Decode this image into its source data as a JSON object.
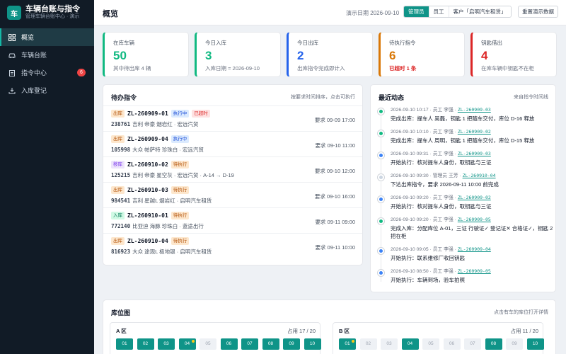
{
  "brand": {
    "logo": "车",
    "title": "车辆台账与指令",
    "subtitle": "管理车辆台账中心 · 演示"
  },
  "nav": [
    {
      "label": "概览",
      "icon": "grid-icon",
      "active": true
    },
    {
      "label": "车辆台账",
      "icon": "car-icon"
    },
    {
      "label": "指令中心",
      "icon": "clipboard-icon",
      "badge": "6"
    },
    {
      "label": "入库登记",
      "icon": "download-icon"
    }
  ],
  "header": {
    "title": "概览",
    "demo_date": "演示日期 2026-09-10",
    "roles": [
      "管理员",
      "员工",
      "客户「启明汽车租赁」"
    ],
    "active_role": "管理员",
    "reset_label": "重置演示数据"
  },
  "stats": [
    {
      "label": "在库车辆",
      "value": "50",
      "sub": "其中待出库 4 辆",
      "color": "#10b981"
    },
    {
      "label": "今日入库",
      "value": "3",
      "sub": "入库日期 = 2026-09-10",
      "color": "#10b981"
    },
    {
      "label": "今日出库",
      "value": "2",
      "sub": "出库指令完成即计入",
      "color": "#2563eb"
    },
    {
      "label": "待执行指令",
      "value": "6",
      "sub": "已超时 1 条",
      "color": "#d97706",
      "sub_color": "#dc2626"
    },
    {
      "label": "钥匙借出",
      "value": "4",
      "sub": "在库车辆中钥匙不在柜",
      "color": "#dc2626"
    }
  ],
  "pending": {
    "title": "待办指令",
    "hint": "按要求时间排序，点击可执行",
    "orders": [
      {
        "type": "出库",
        "type_class": "",
        "code": "ZL-260909-01",
        "status": "执行中",
        "status_class": "",
        "overdue": "已超时",
        "plate": "238761",
        "desc": "吉利 帝豪 烟岩红 · 宏远汽贸",
        "due": "要求 09-09 17:00"
      },
      {
        "type": "出库",
        "type_class": "",
        "code": "ZL-260909-04",
        "status": "执行中",
        "status_class": "",
        "plate": "105998",
        "desc": "大众 帕萨特 珍珠白 · 宏远汽贸",
        "due": "要求 09-10 11:00"
      },
      {
        "type": "移库",
        "type_class": "mv",
        "code": "ZL-260910-02",
        "status": "待执行",
        "status_class": "wait",
        "plate": "125215",
        "desc": "吉利 帝豪 星空灰 · 宏远汽贸 · A-14 → D-19",
        "due": "要求 09-10 12:00"
      },
      {
        "type": "出库",
        "type_class": "",
        "code": "ZL-260910-03",
        "status": "待执行",
        "status_class": "wait",
        "plate": "984541",
        "desc": "吉利 星越L 烟岩红 · 启明汽车租赁",
        "due": "要求 09-10 16:00"
      },
      {
        "type": "入库",
        "type_class": "in",
        "code": "ZL-260910-01",
        "status": "待执行",
        "status_class": "wait",
        "plate": "772140",
        "desc": "比亚迪 海豚 珍珠白 · 蓝途出行",
        "due": "要求 09-11 09:00"
      },
      {
        "type": "出库",
        "type_class": "",
        "code": "ZL-260910-04",
        "status": "待执行",
        "status_class": "wait",
        "plate": "816923",
        "desc": "大众 途观L 极地银 · 启明汽车租赁",
        "due": "要求 09-11 10:00"
      }
    ]
  },
  "activity": {
    "title": "最近动态",
    "hint": "来自指令时间线",
    "items": [
      {
        "meta": "2026-09-10 10:17 · 员工 李强 · ",
        "link": "ZL-260909-03",
        "text": "完成出库：提车人 吴磊，钥匙 1 把随车交付，库位 D-16 释放",
        "dot": "green"
      },
      {
        "meta": "2026-09-10 10:10 · 员工 李强 · ",
        "link": "ZL-260909-02",
        "text": "完成出库：提车人 周明，钥匙 1 把随车交付，库位 D-15 释放",
        "dot": "green"
      },
      {
        "meta": "2026-09-10 09:31 · 员工 李强 · ",
        "link": "ZL-260909-03",
        "text": "开始执行：核对提车人身份，取钥匙与三证",
        "dot": "blue"
      },
      {
        "meta": "2026-09-10 09:30 · 管理员 王芳 · ",
        "link": "ZL-260910-04",
        "text": "下达出库指令，要求 2026-09-11 10:00 前完成",
        "dot": "gray"
      },
      {
        "meta": "2026-09-10 09:20 · 员工 李强 · ",
        "link": "ZL-260909-02",
        "text": "开始执行：核对提车人身份，取钥匙与三证",
        "dot": "blue"
      },
      {
        "meta": "2026-09-10 09:20 · 员工 李强 · ",
        "link": "ZL-260909-05",
        "text": "完成入库：分配库位 A-01，三证 行驶证✓ 登记证✕ 合格证✓，钥匙 2 把在柜",
        "dot": "green",
        "tall": true
      },
      {
        "meta": "2026-09-10 09:05 · 员工 李强 · ",
        "link": "ZL-260909-04",
        "text": "开始执行：联系维修厂收回钥匙",
        "dot": "blue"
      },
      {
        "meta": "2026-09-10 08:50 · 员工 李强 · ",
        "link": "ZL-260909-05",
        "text": "开始执行：车辆到场，验车拍照",
        "dot": "blue"
      }
    ]
  },
  "parking": {
    "title": "库位图",
    "hint": "点击有车的库位打开详情",
    "zones": [
      {
        "name": "A 区",
        "occupancy": "占用 17 / 20",
        "slots": [
          {
            "n": "01",
            "occ": true
          },
          {
            "n": "02",
            "occ": true
          },
          {
            "n": "03",
            "occ": true
          },
          {
            "n": "04",
            "occ": true,
            "dot": true
          },
          {
            "n": "05",
            "occ": false
          },
          {
            "n": "06",
            "occ": true
          },
          {
            "n": "07",
            "occ": true
          },
          {
            "n": "08",
            "occ": true
          },
          {
            "n": "09",
            "occ": true
          },
          {
            "n": "10",
            "occ": true
          }
        ]
      },
      {
        "name": "B 区",
        "occupancy": "占用 11 / 20",
        "slots": [
          {
            "n": "01",
            "occ": true,
            "dot": true
          },
          {
            "n": "02",
            "occ": false
          },
          {
            "n": "03",
            "occ": false
          },
          {
            "n": "04",
            "occ": true
          },
          {
            "n": "05",
            "occ": false
          },
          {
            "n": "06",
            "occ": false
          },
          {
            "n": "07",
            "occ": false
          },
          {
            "n": "08",
            "occ": true
          },
          {
            "n": "09",
            "occ": false
          },
          {
            "n": "10",
            "occ": true
          }
        ]
      }
    ]
  }
}
